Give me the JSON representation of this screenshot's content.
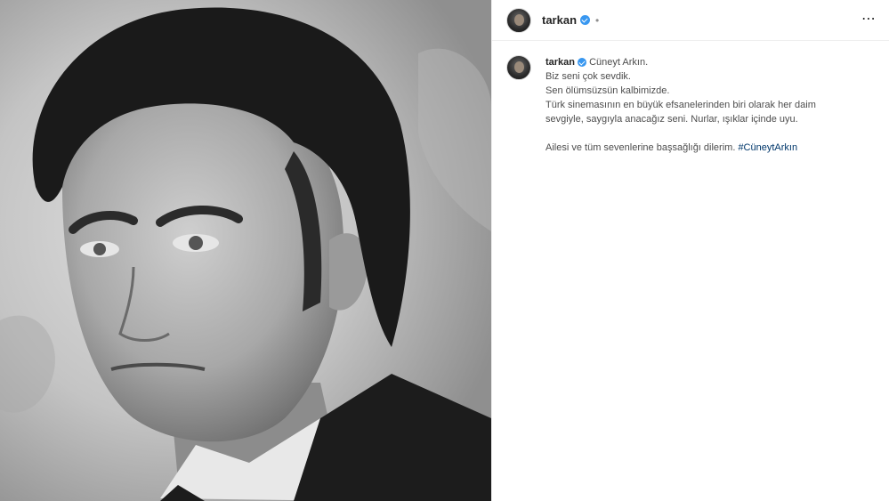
{
  "post": {
    "author": "tarkan",
    "header_separator": "•",
    "more_icon": "⋯",
    "caption": {
      "first_line": "Cüneyt Arkın.",
      "lines": [
        "Biz seni çok sevdik.",
        "Sen ölümsüzsün kalbimizde.",
        "Türk sinemasının en büyük efsanelerinden biri olarak her daim",
        "sevgiyle, saygıyla anacağız seni. Nurlar, ışıklar içinde uyu."
      ],
      "condolence": "Ailesi ve tüm sevenlerine başsağlığı dilerim.",
      "hashtag": "#CüneytArkın"
    }
  },
  "colors": {
    "verified": "#3897f0",
    "hashtag": "#00376b",
    "text": "#262626"
  },
  "icons": {
    "verified": "verified-badge-icon",
    "more": "more-options-icon"
  }
}
